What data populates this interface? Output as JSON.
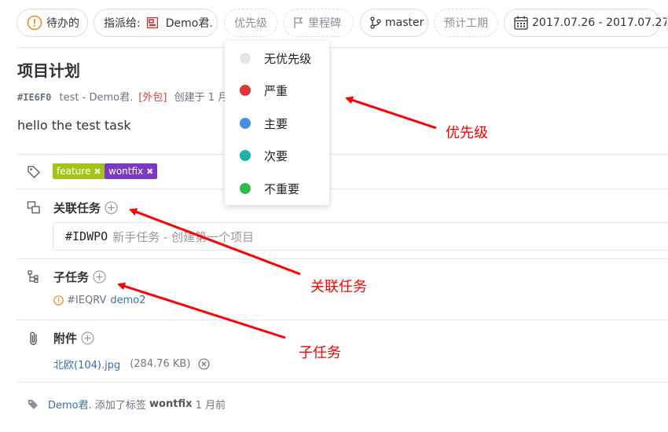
{
  "toolbar": {
    "status_label": "待办的",
    "assignee_prefix": "指派给:",
    "assignee_name": "Demo君.",
    "priority_label": "优先级",
    "milestone_label": "里程碑",
    "branch_label": "master",
    "plan_label": "预计工期",
    "date_range": "2017.07.26 - 2017.07.27"
  },
  "task": {
    "title": "项目计划",
    "code": "#IE6F0",
    "project": "test",
    "separator": " - ",
    "author": "Demo君.",
    "badge": "[外包]",
    "created": "创建于 1 月",
    "description": "hello the test task"
  },
  "tags": [
    {
      "label": "feature",
      "color": "#a4c416"
    },
    {
      "label": "wontfix",
      "color": "#7c3ac2"
    }
  ],
  "related": {
    "title": "关联任务",
    "code": "#IDWPO",
    "placeholder": "新手任务 - 创建第一个项目"
  },
  "subtasks": {
    "title": "子任务",
    "items": [
      {
        "code": "#IEQRV",
        "name": "demo2"
      }
    ]
  },
  "attachments": {
    "title": "附件",
    "file": "北欧(104).jpg",
    "size": "(284.76 KB)"
  },
  "activity": {
    "user": "Demo君.",
    "action": " 添加了标签 ",
    "tag": "wontfix",
    "time": " 1 月前"
  },
  "priority_menu": {
    "items": [
      {
        "label": "无优先级",
        "color": "#e6e6e6"
      },
      {
        "label": "严重",
        "color": "#e03535"
      },
      {
        "label": "主要",
        "color": "#4a90e2"
      },
      {
        "label": "次要",
        "color": "#17b3a8"
      },
      {
        "label": "不重要",
        "color": "#2ebb4a"
      }
    ]
  },
  "annotations": {
    "priority": "优先级",
    "related": "关联任务",
    "subtask": "子任务"
  }
}
